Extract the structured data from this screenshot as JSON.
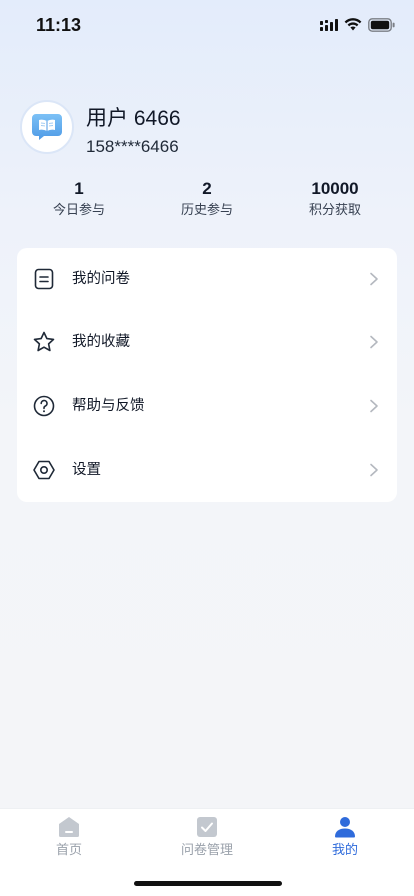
{
  "status_bar": {
    "time": "11:13"
  },
  "profile": {
    "name": "用户 6466",
    "phone": "158****6466"
  },
  "stats": [
    {
      "value": "1",
      "label": "今日参与"
    },
    {
      "value": "2",
      "label": "历史参与"
    },
    {
      "value": "10000",
      "label": "积分获取"
    }
  ],
  "menu": {
    "items": [
      {
        "label": "我的问卷",
        "icon": "document-icon"
      },
      {
        "label": "我的收藏",
        "icon": "star-icon"
      },
      {
        "label": "帮助与反馈",
        "icon": "help-icon"
      },
      {
        "label": "设置",
        "icon": "settings-icon"
      }
    ]
  },
  "tab_bar": {
    "tabs": [
      {
        "label": "首页",
        "icon": "home-icon",
        "active": false
      },
      {
        "label": "问卷管理",
        "icon": "checkbox-icon",
        "active": false
      },
      {
        "label": "我的",
        "icon": "user-icon",
        "active": true
      }
    ]
  },
  "colors": {
    "accent": "#2f6bdb",
    "inactive_tab": "#9aa1ab",
    "avatar_icon": "#5aa9ee"
  }
}
